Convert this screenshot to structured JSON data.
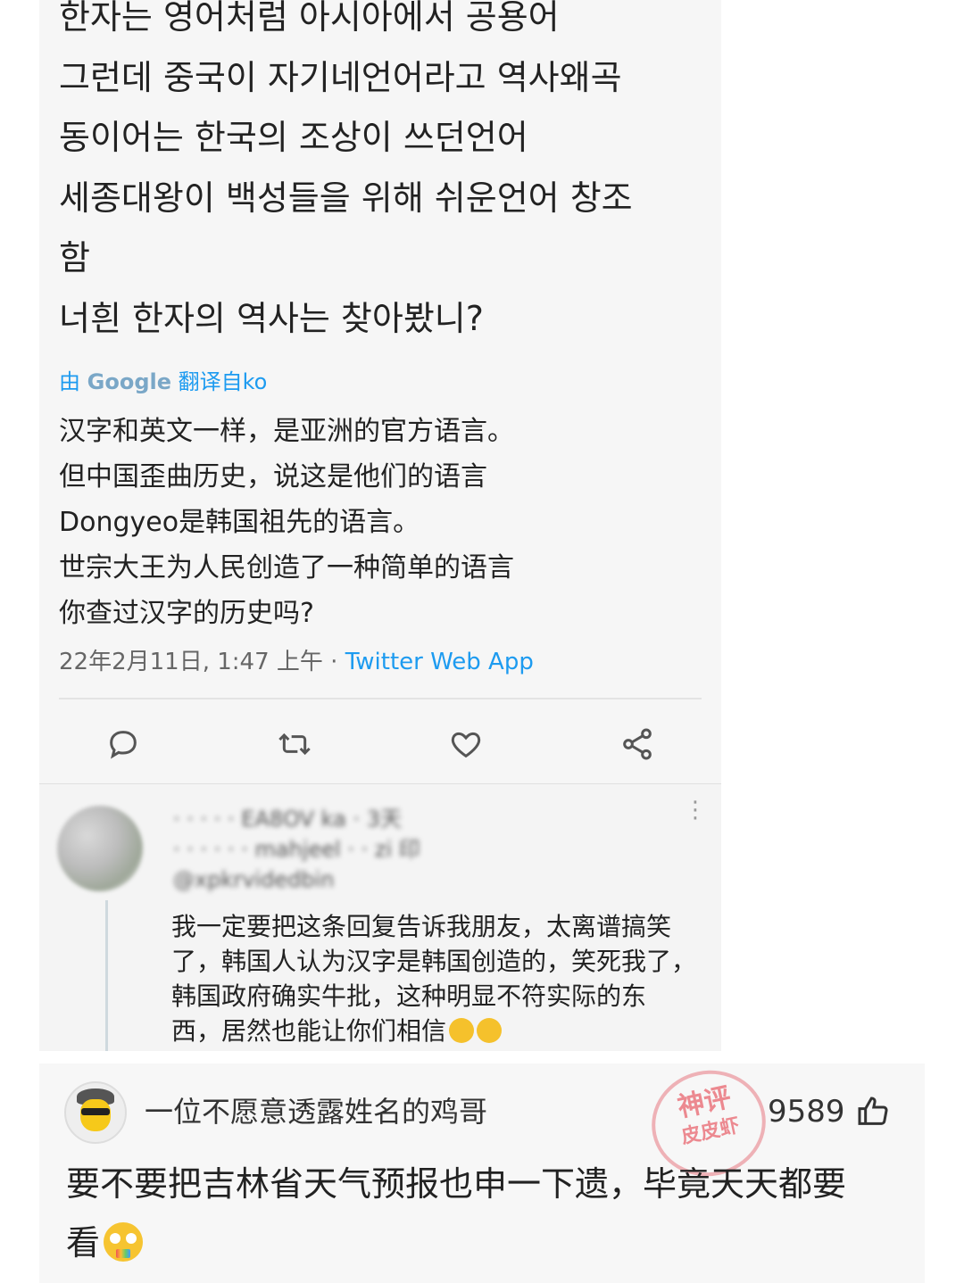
{
  "tweet": {
    "korean_lines": [
      "한자는 영어처럼 아시아에서 공용어",
      "그런데 중국이 자기네언어라고 역사왜곡",
      "동이어는 한국의 조상이 쓰던언어",
      "세종대왕이 백성들을 위해 쉬운언어 창조",
      "함",
      "너흰 한자의 역사는 찾아봤니?"
    ],
    "translate_prefix": "由",
    "translate_brand": "Google",
    "translate_suffix": "翻译自ko",
    "chinese_lines": [
      "汉字和英文一样，是亚洲的官方语言。",
      "但中国歪曲历史，说这是他们的语言",
      "Dongyeo是韩国祖先的语言。",
      "世宗大王为人民创造了一种简单的语言",
      "你查过汉字的历史吗?"
    ],
    "timestamp": "22年2月11日, 1:47 上午 · ",
    "source_app": "Twitter Web App",
    "actions": [
      "reply-icon",
      "retweet-icon",
      "like-icon",
      "share-icon"
    ]
  },
  "reply": {
    "blurred_header": "· · · · · EA8OV ka · 3天",
    "blurred_subheader": "· · · · · · mahjeel · · zi 印",
    "blurred_handle": "@xpkrvidedbin",
    "text_lines": [
      "我一定要把这条回复告诉我朋友，太离谱搞笑",
      "了，韩国人认为汉字是韩国创造的，笑死我了，",
      "韩国政府确实牛批，这种明显不符实际的东",
      "西，居然也能让你们相信"
    ],
    "emoji": "rolling-on-floor-laughing-emoji"
  },
  "comment": {
    "username": "一位不愿意透露姓名的鸡哥",
    "stamp_line1": "神评",
    "stamp_line2": "皮皮虾",
    "likes": "9589",
    "text_lines": [
      "要不要把吉林省天气预报也申一下遗，毕竟天天都要",
      "看"
    ],
    "emoji": "flushed-face-emoji"
  },
  "colors": {
    "link": "#1d9bf0",
    "card_bg": "#f6f6f6",
    "stamp": "#e8646e"
  }
}
